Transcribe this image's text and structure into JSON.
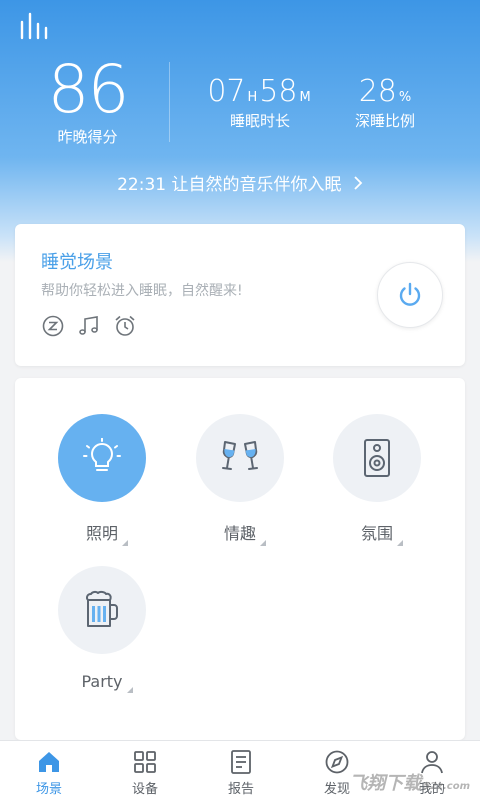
{
  "header": {
    "score": {
      "value": "86",
      "label": "昨晚得分"
    },
    "duration": {
      "hours": "07",
      "h_unit": "H",
      "minutes": "58",
      "m_unit": "M",
      "label": "睡眠时长"
    },
    "deep_sleep": {
      "value": "28",
      "unit": "%",
      "label": "深睡比例"
    },
    "music_prompt": {
      "time": "22:31",
      "text": "让自然的音乐伴你入眠"
    }
  },
  "sleep_scene": {
    "title": "睡觉场景",
    "subtitle": "帮助你轻松进入睡眠，自然醒来!",
    "icons": [
      "snooze-icon",
      "music-note-icon",
      "alarm-clock-icon"
    ],
    "power": "power-icon"
  },
  "scenes": [
    {
      "label": "照明",
      "icon": "light-bulb-icon",
      "active": true
    },
    {
      "label": "情趣",
      "icon": "wine-glasses-icon",
      "active": false
    },
    {
      "label": "氛围",
      "icon": "speaker-icon",
      "active": false
    },
    {
      "label": "Party",
      "icon": "beer-mug-icon",
      "active": false
    }
  ],
  "tabs": [
    {
      "label": "场景",
      "icon": "home-icon",
      "active": true
    },
    {
      "label": "设备",
      "icon": "grid-icon",
      "active": false
    },
    {
      "label": "报告",
      "icon": "report-icon",
      "active": false
    },
    {
      "label": "发现",
      "icon": "compass-icon",
      "active": false
    },
    {
      "label": "我的",
      "icon": "user-icon",
      "active": false
    }
  ],
  "watermark": {
    "text": "飞翔下载",
    "sub": "52z.com"
  },
  "colors": {
    "accent": "#3d96e6",
    "header_top": "#3d96e6",
    "active_circle": "#66b1f0"
  }
}
